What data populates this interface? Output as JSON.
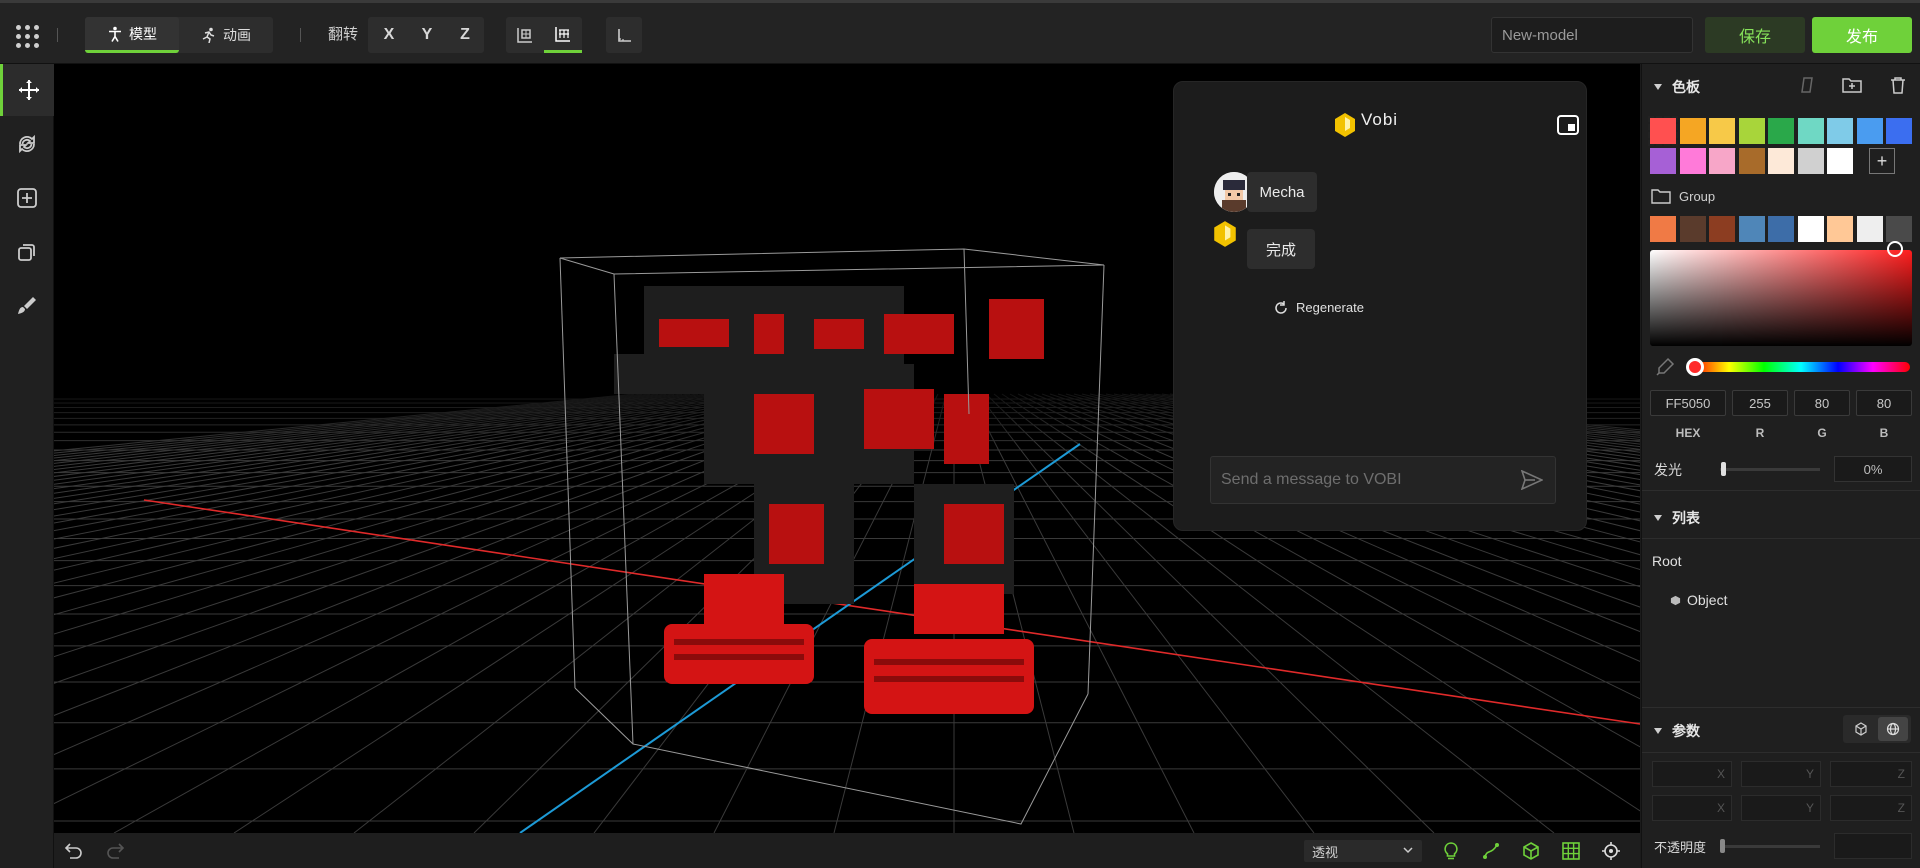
{
  "topbar": {
    "modes": [
      {
        "label": "模型",
        "icon": "person-icon",
        "active": true
      },
      {
        "label": "动画",
        "icon": "running-icon",
        "active": false
      }
    ],
    "flip_label": "翻转",
    "axes": [
      "X",
      "Y",
      "Z"
    ],
    "model_name": "New-model",
    "save_label": "保存",
    "publish_label": "发布",
    "accent_color": "#6fd13a"
  },
  "left_tools": [
    "move-icon",
    "rotate-icon",
    "add-icon",
    "duplicate-icon",
    "brush-icon"
  ],
  "chat": {
    "title": "Vobi",
    "messages": [
      {
        "role": "user",
        "text": "Mecha"
      },
      {
        "role": "assistant",
        "text": "完成"
      }
    ],
    "regenerate_label": "Regenerate",
    "input_placeholder": "Send a message to VOBI"
  },
  "bottombar": {
    "view_mode": "透视",
    "icons": [
      "bulb-icon",
      "path-icon",
      "cube-icon",
      "grid-icon",
      "target-icon"
    ]
  },
  "panel": {
    "palette_title": "色板",
    "palette_colors": [
      "#ff5050",
      "#f5a623",
      "#f7c948",
      "#a8d53a",
      "#2aa84a",
      "#6fd8c4",
      "#7fcbe8",
      "#4a9cf0",
      "#3b6ef0",
      "#a660d6",
      "#ff7ad9",
      "#f7a6c8",
      "#a86b2a",
      "#fde9d8",
      "#d0d0d0",
      "#ffffff"
    ],
    "group_label": "Group",
    "group_colors": [
      "#f07a45",
      "#5a3b2c",
      "#8c3d21",
      "#4f86b8",
      "#3d6da8",
      "#ffffff",
      "#ffc896",
      "#eeeeee",
      "#4a4a4a"
    ],
    "color": {
      "hex": "FF5050",
      "r": "255",
      "g": "80",
      "b": "80"
    },
    "labels": {
      "hex": "HEX",
      "r": "R",
      "g": "G",
      "b": "B"
    },
    "glow_label": "发光",
    "glow_value": "0%",
    "list_title": "列表",
    "tree_root": "Root",
    "tree_object": "Object",
    "params_title": "参数",
    "param_axes": [
      "X",
      "Y",
      "Z"
    ],
    "opacity_label": "不透明度"
  }
}
